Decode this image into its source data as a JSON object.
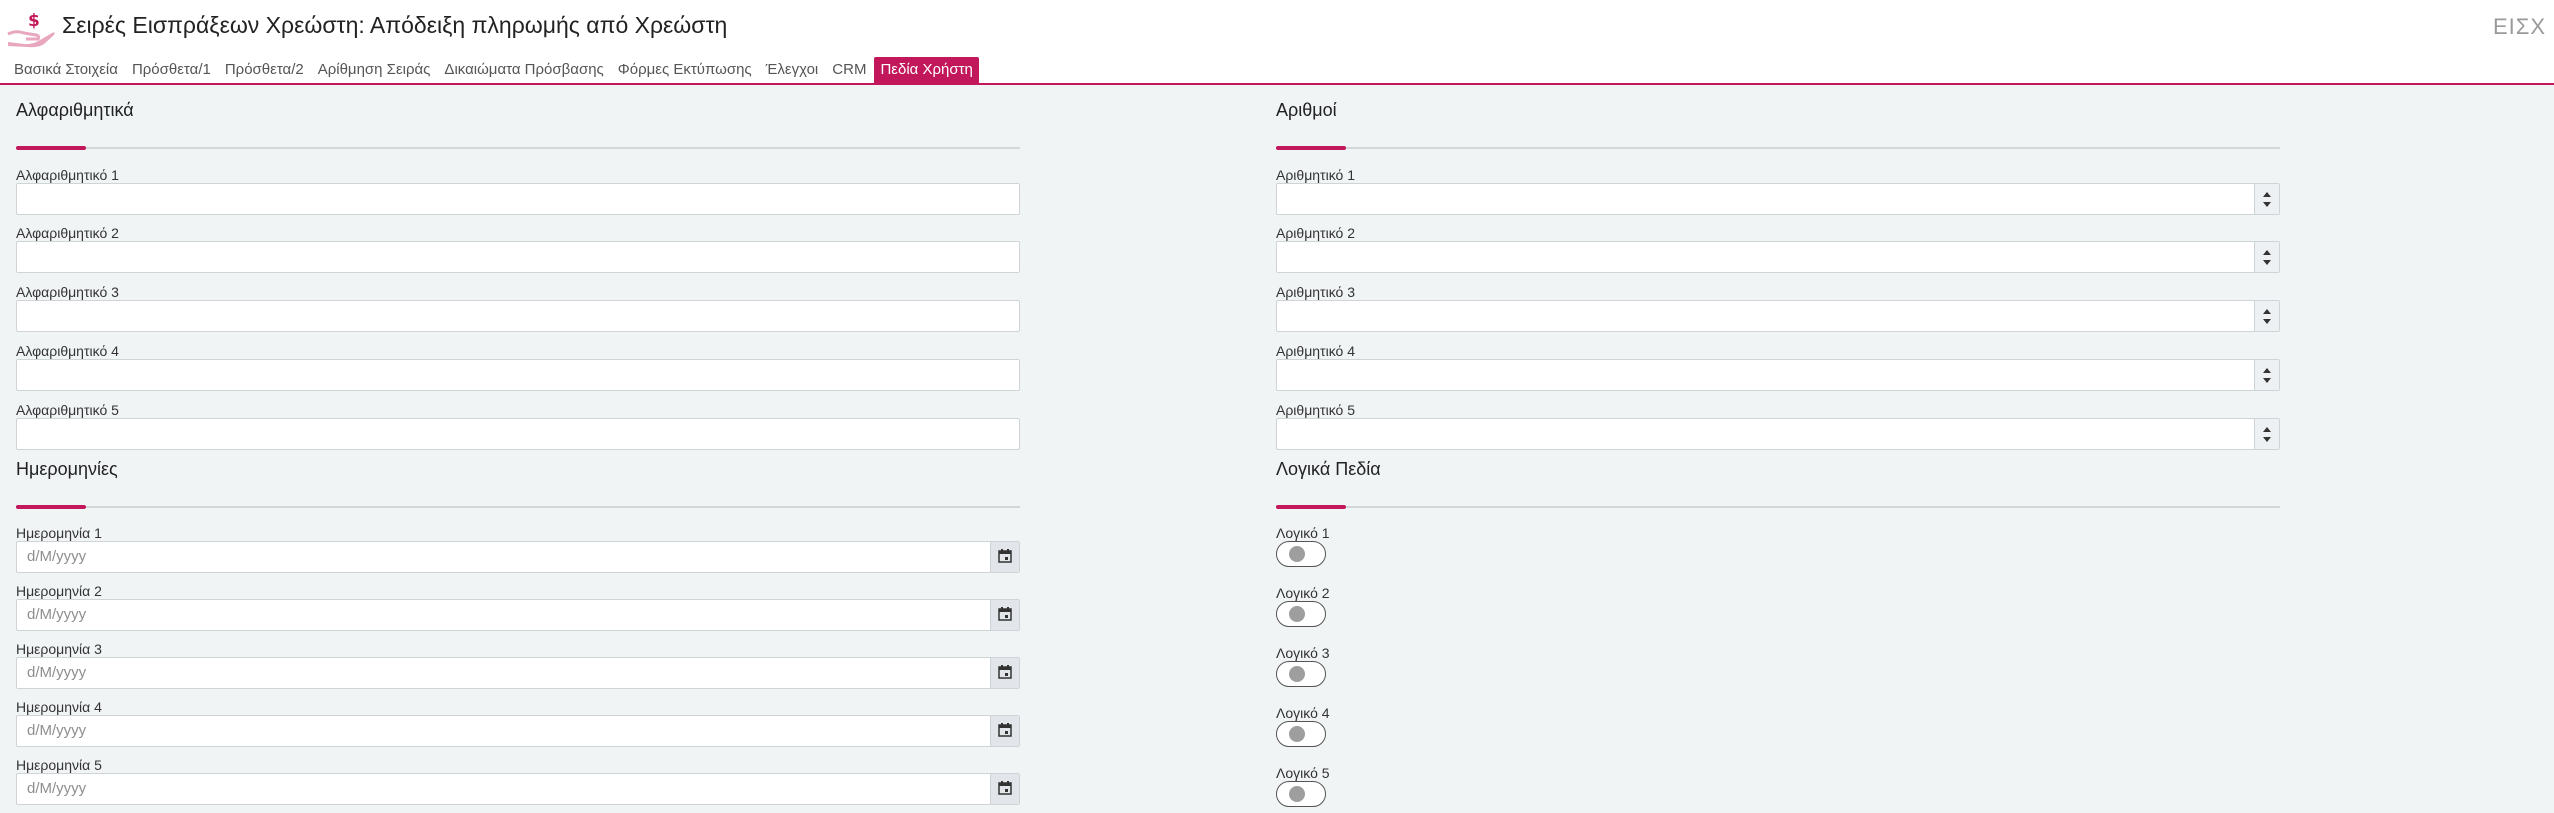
{
  "header": {
    "title": "Σειρές Εισπράξεων Χρεώστη: Απόδειξη πληρωμής από Χρεώστη",
    "code": "ΕΙΣΧ",
    "icon": "hand-money-icon",
    "accent_color": "#c2185b"
  },
  "tabs": [
    {
      "label": "Βασικά Στοιχεία",
      "active": false
    },
    {
      "label": "Πρόσθετα/1",
      "active": false
    },
    {
      "label": "Πρόσθετα/2",
      "active": false
    },
    {
      "label": "Αρίθμηση Σειράς",
      "active": false
    },
    {
      "label": "Δικαιώματα Πρόσβασης",
      "active": false
    },
    {
      "label": "Φόρμες Εκτύπωσης",
      "active": false
    },
    {
      "label": "Έλεγχοι",
      "active": false
    },
    {
      "label": "CRM",
      "active": false
    },
    {
      "label": "Πεδία Χρήστη",
      "active": true
    }
  ],
  "alpha": {
    "title": "Αλφαριθμητικά",
    "fields": [
      {
        "label": "Αλφαριθμητικό 1",
        "value": ""
      },
      {
        "label": "Αλφαριθμητικό 2",
        "value": ""
      },
      {
        "label": "Αλφαριθμητικό 3",
        "value": ""
      },
      {
        "label": "Αλφαριθμητικό 4",
        "value": ""
      },
      {
        "label": "Αλφαριθμητικό 5",
        "value": ""
      }
    ]
  },
  "numbers": {
    "title": "Αριθμοί",
    "fields": [
      {
        "label": "Αριθμητικό 1",
        "value": ""
      },
      {
        "label": "Αριθμητικό 2",
        "value": ""
      },
      {
        "label": "Αριθμητικό 3",
        "value": ""
      },
      {
        "label": "Αριθμητικό 4",
        "value": ""
      },
      {
        "label": "Αριθμητικό 5",
        "value": ""
      }
    ]
  },
  "dates": {
    "title": "Ημερομηνίες",
    "placeholder": "d/M/yyyy",
    "fields": [
      {
        "label": "Ημερομηνία 1",
        "value": ""
      },
      {
        "label": "Ημερομηνία 2",
        "value": ""
      },
      {
        "label": "Ημερομηνία 3",
        "value": ""
      },
      {
        "label": "Ημερομηνία 4",
        "value": ""
      },
      {
        "label": "Ημερομηνία 5",
        "value": ""
      }
    ]
  },
  "logicals": {
    "title": "Λογικά Πεδία",
    "fields": [
      {
        "label": "Λογικό 1",
        "checked": false
      },
      {
        "label": "Λογικό 2",
        "checked": false
      },
      {
        "label": "Λογικό 3",
        "checked": false
      },
      {
        "label": "Λογικό 4",
        "checked": false
      },
      {
        "label": "Λογικό 5",
        "checked": false
      }
    ]
  }
}
